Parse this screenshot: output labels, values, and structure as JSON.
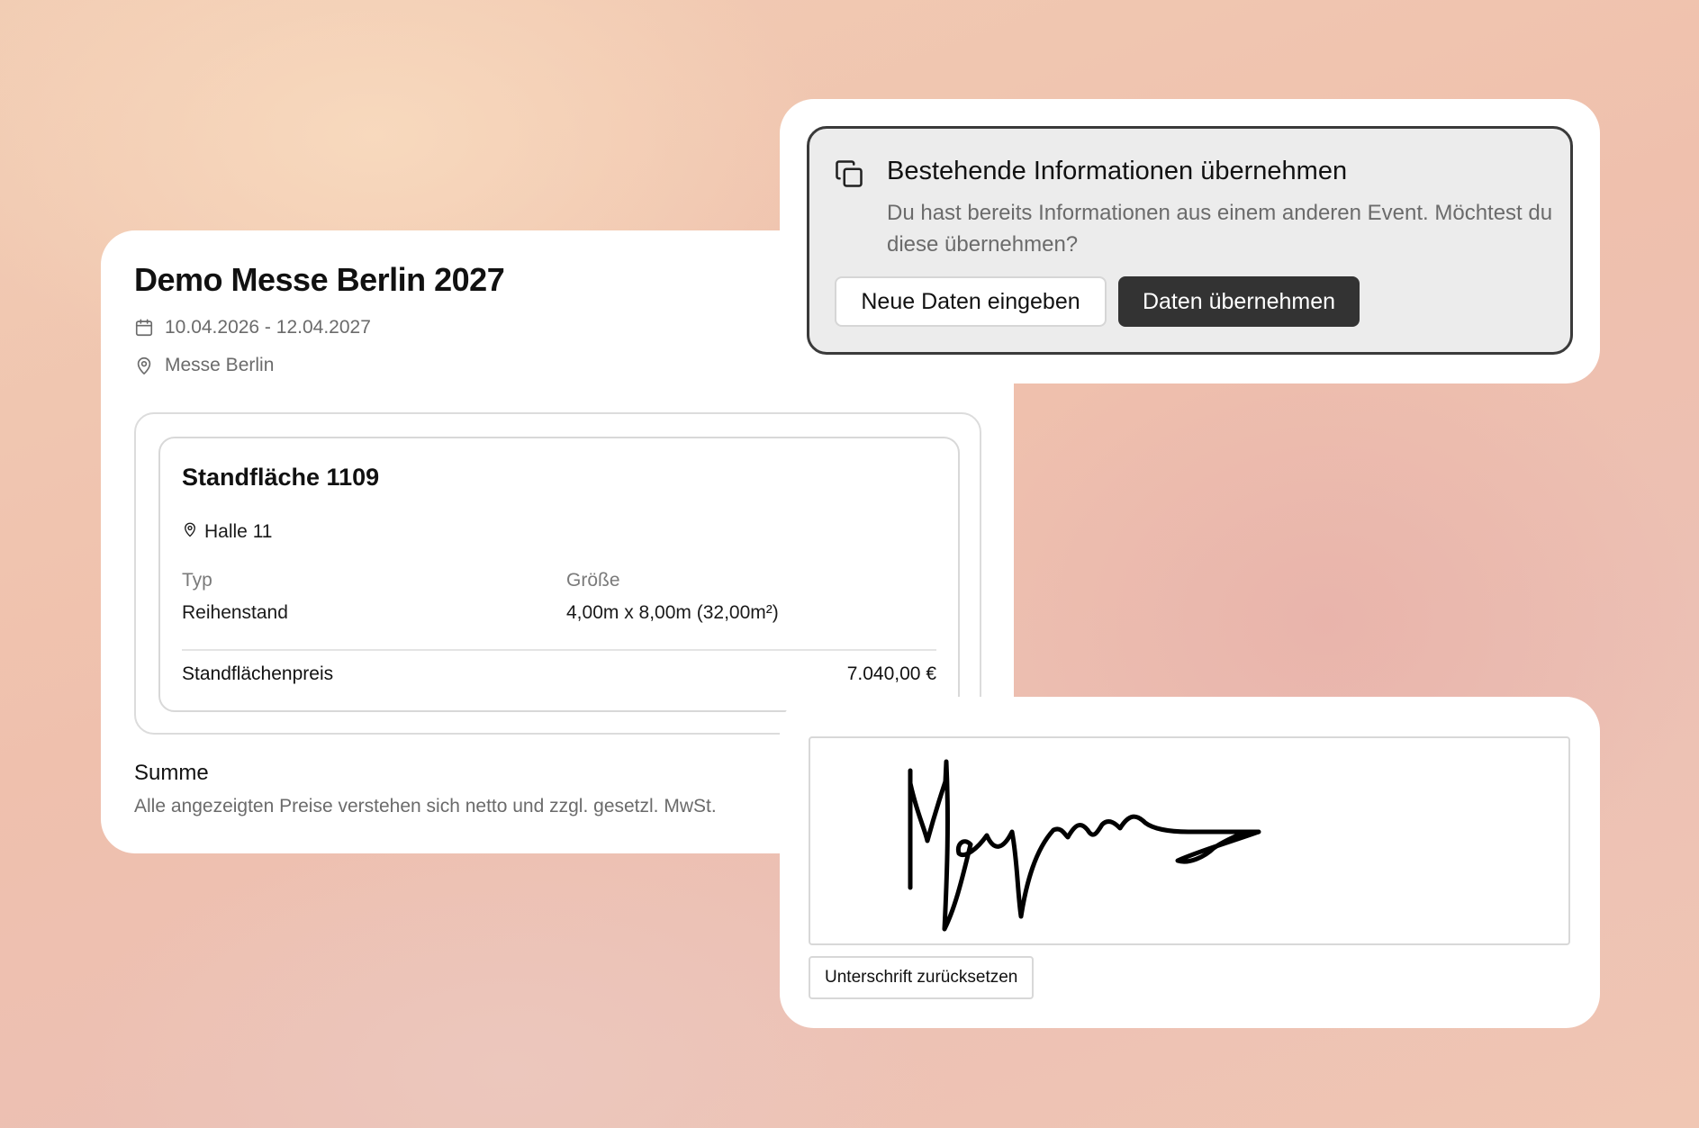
{
  "event": {
    "title": "Demo Messe Berlin 2027",
    "date_range": "10.04.2026 - 12.04.2027",
    "venue": "Messe Berlin",
    "stand": {
      "title": "Standfläche 1109",
      "hall": "Halle 11",
      "type_label": "Typ",
      "type_value": "Reihenstand",
      "size_label": "Größe",
      "size_value": "4,00m x 8,00m (32,00m²)",
      "price_label": "Standflächenpreis",
      "price_value": "7.040,00 €"
    },
    "summary": {
      "title": "Summe",
      "note": "Alle angezeigten Preise verstehen sich netto und zzgl. gesetzl. MwSt."
    }
  },
  "import_dialog": {
    "title": "Bestehende Informationen übernehmen",
    "description": "Du hast bereits Informationen aus einem anderen Event. Möchtest du diese übernehmen?",
    "new_data_label": "Neue Daten eingeben",
    "accept_label": "Daten übernehmen"
  },
  "signature": {
    "reset_label": "Unterschrift zurücksetzen"
  },
  "icons": {
    "date": "calendar-icon",
    "venue": "map-pin-icon",
    "hall": "map-pin-icon",
    "import": "copy-icon"
  },
  "colors": {
    "primary_button": "#333333",
    "panel_background": "#ececec",
    "muted_text": "#6b6b6b"
  }
}
